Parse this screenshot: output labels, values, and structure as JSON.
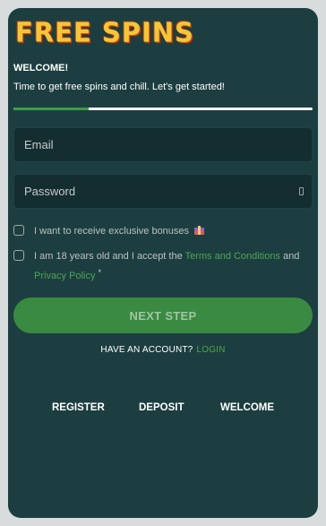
{
  "brand": {
    "logo_text": "FREE SPINS"
  },
  "intro": {
    "heading": "WELCOME!",
    "subtitle": "Time to get free spins and chill. Let's get started!"
  },
  "progress": {
    "fraction": 0.25
  },
  "form": {
    "email_placeholder": "Email",
    "password_placeholder": "Password",
    "checkbox_bonuses": "I want to receive exclusive bonuses",
    "checkbox_terms_prefix": "I am 18 years old and I accept the",
    "terms_link": "Terms and Conditions",
    "checkbox_terms_and": "and",
    "privacy_link": "Privacy Policy",
    "required_marker": "*",
    "next_button": "NEXT STEP"
  },
  "account": {
    "prompt": "HAVE AN ACCOUNT?",
    "login_link": "LOGIN"
  },
  "footer_nav": {
    "register": "REGISTER",
    "deposit": "DEPOSIT",
    "welcome": "WELCOME"
  },
  "colors": {
    "background": "#1d3e40",
    "accent_green": "#3e9c49",
    "logo_yellow": "#f3c63a",
    "field_bg": "#142d30"
  },
  "icons": [
    "gift-icon",
    "eye-icon"
  ]
}
